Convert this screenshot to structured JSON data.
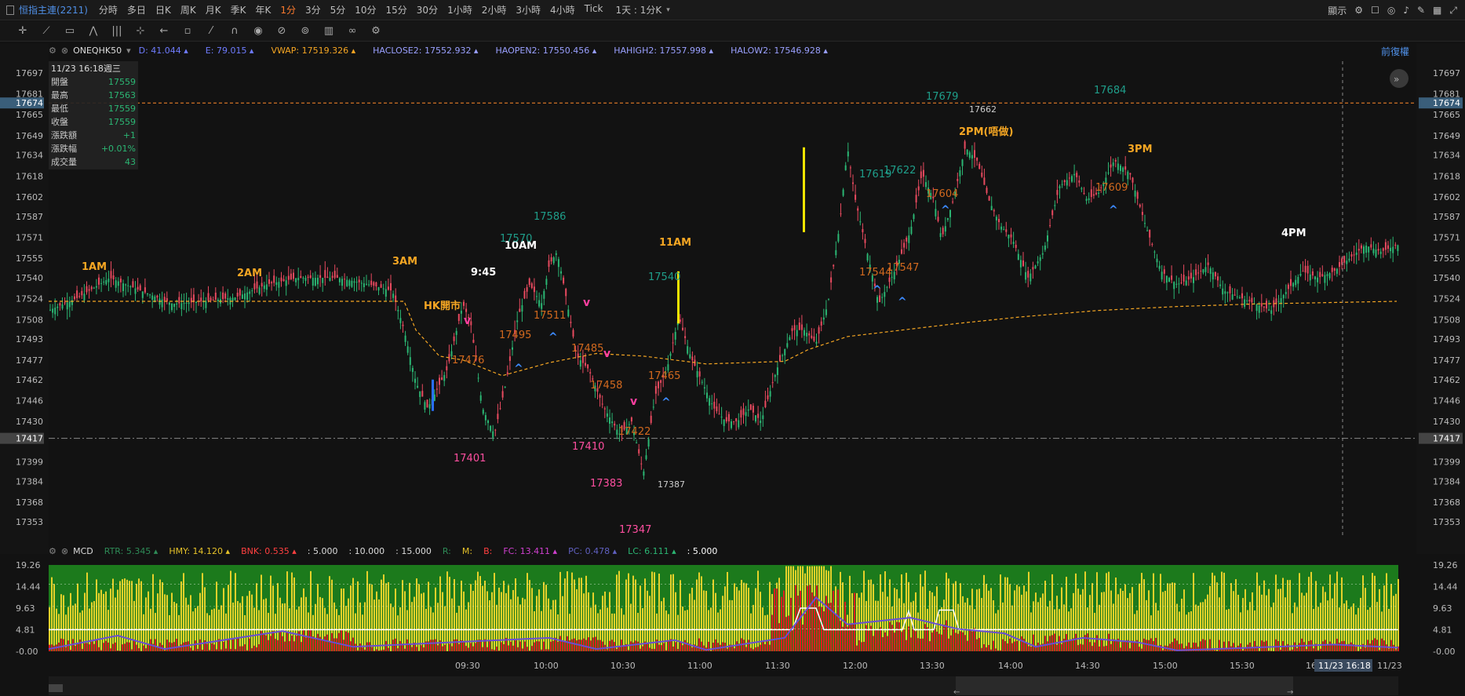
{
  "topbar": {
    "title": "恒指主連(2211)",
    "timeframes": [
      "分時",
      "多日",
      "日K",
      "周K",
      "月K",
      "季K",
      "年K",
      "1分",
      "3分",
      "5分",
      "10分",
      "15分",
      "30分",
      "1小時",
      "2小時",
      "3小時",
      "4小時",
      "Tick"
    ],
    "active_timeframe": "1分",
    "range_select": "1天 : 1分K",
    "display_label": "顯示",
    "icons": [
      "settings-icon",
      "square-icon",
      "camera-icon",
      "bell-icon",
      "pencil-icon",
      "layout-icon",
      "fullscreen-icon"
    ]
  },
  "toolbar": {
    "tools": [
      "crosshair-icon",
      "line-tool-icon",
      "rect-tool-icon",
      "zigzag-tool-icon",
      "bars-tool-icon",
      "move-tool-icon",
      "arrow-tool-icon",
      "bubble-icon",
      "brush-icon",
      "magnet-icon",
      "layers-icon",
      "eye-off-icon",
      "lock-icon",
      "trash-icon",
      "link-icon",
      "gear-icon"
    ]
  },
  "main_legend": {
    "name": "ONEQHK50",
    "items": [
      {
        "label": "D:",
        "value": "41.044",
        "color": "#6f7cff"
      },
      {
        "label": "E:",
        "value": "79.015",
        "color": "#6f7cff"
      },
      {
        "label": "VWAP:",
        "value": "17519.326",
        "color": "#f5a623"
      },
      {
        "label": "HACLOSE2:",
        "value": "17552.932",
        "color": "#9aa0ff"
      },
      {
        "label": "HAOPEN2:",
        "value": "17550.456",
        "color": "#9aa0ff"
      },
      {
        "label": "HAHIGH2:",
        "value": "17557.998",
        "color": "#9aa0ff"
      },
      {
        "label": "HALOW2:",
        "value": "17546.928",
        "color": "#9aa0ff"
      }
    ],
    "adjust_label": "前復權"
  },
  "infobox": {
    "datetime": "11/23 16:18週三",
    "rows": [
      {
        "label": "開盤",
        "value": "17559"
      },
      {
        "label": "最高",
        "value": "17563"
      },
      {
        "label": "最低",
        "value": "17559"
      },
      {
        "label": "收盤",
        "value": "17559"
      },
      {
        "label": "漲跌額",
        "value": "+1"
      },
      {
        "label": "漲跌幅",
        "value": "+0.01%"
      },
      {
        "label": "成交量",
        "value": "43"
      }
    ]
  },
  "price_axis": {
    "ticks": [
      "17697",
      "17681",
      "17665",
      "17649",
      "17634",
      "17618",
      "17602",
      "17587",
      "17571",
      "17555",
      "17540",
      "17524",
      "17508",
      "17493",
      "17477",
      "17462",
      "17446",
      "17430",
      "17417",
      "17399",
      "17384",
      "17368",
      "17353"
    ],
    "highlight_top": "17674",
    "highlight_bottom": "17417"
  },
  "annotations": {
    "orange": [
      {
        "text": "1AM"
      },
      {
        "text": "2AM"
      },
      {
        "text": "3AM"
      },
      {
        "text": "HK開市"
      },
      {
        "text": "11AM"
      },
      {
        "text": "2PM(唔做)"
      },
      {
        "text": "3PM"
      }
    ],
    "white": [
      {
        "text": "10AM"
      },
      {
        "text": "9:45"
      },
      {
        "text": "4PM"
      }
    ],
    "teal_prices": [
      "17570",
      "17586",
      "17540",
      "17619",
      "17622",
      "17679",
      "17684"
    ],
    "orange_prices": [
      "17476",
      "17495",
      "17511",
      "17485",
      "17458",
      "17465",
      "17422",
      "17544",
      "17547",
      "17604",
      "17609"
    ],
    "pink_prices": [
      "17401",
      "17410",
      "17383",
      "17347"
    ],
    "gray_prices": [
      "17662",
      "17387"
    ]
  },
  "mcd_legend": {
    "name": "MCD",
    "items": [
      {
        "label": "RTR:",
        "value": "5.345",
        "color": "#2e8b57"
      },
      {
        "label": "HMY:",
        "value": "14.120",
        "color": "#e6c229"
      },
      {
        "label": "BNK:",
        "value": "0.535",
        "color": "#ff4040"
      },
      {
        "label": "",
        "value": ": 5.000",
        "color": "#dddddd"
      },
      {
        "label": "",
        "value": ": 10.000",
        "color": "#dddddd"
      },
      {
        "label": "",
        "value": ": 15.000",
        "color": "#dddddd"
      },
      {
        "label": "R:",
        "value": "",
        "color": "#2e8b57"
      },
      {
        "label": "M:",
        "value": "",
        "color": "#e6c229"
      },
      {
        "label": "B:",
        "value": "",
        "color": "#ff4040"
      },
      {
        "label": "FC:",
        "value": "13.411",
        "color": "#d040d0"
      },
      {
        "label": "PC:",
        "value": "0.478",
        "color": "#6060c0"
      },
      {
        "label": "LC:",
        "value": "6.111",
        "color": "#2bb673"
      },
      {
        "label": "",
        "value": ": 5.000",
        "color": "#ffffff"
      }
    ]
  },
  "mcd_axis": {
    "ticks": [
      "19.26",
      "14.44",
      "9.63",
      "4.81",
      "-0.00"
    ]
  },
  "time_axis": {
    "ticks": [
      "09:30",
      "10:00",
      "10:30",
      "11:00",
      "11:30",
      "12:00",
      "13:30",
      "14:00",
      "14:30",
      "15:00",
      "15:30",
      "16:0"
    ],
    "cursor_label": "11/23 16:18",
    "date_label": "11/23"
  },
  "colors": {
    "up": "#2bb673",
    "down": "#e84a5f",
    "vwap": "#f5a623",
    "bg": "#121212",
    "mcd_green": "#1c7a1c",
    "mcd_yellow": "#e6d12a",
    "mcd_red": "#e01e1e"
  }
}
